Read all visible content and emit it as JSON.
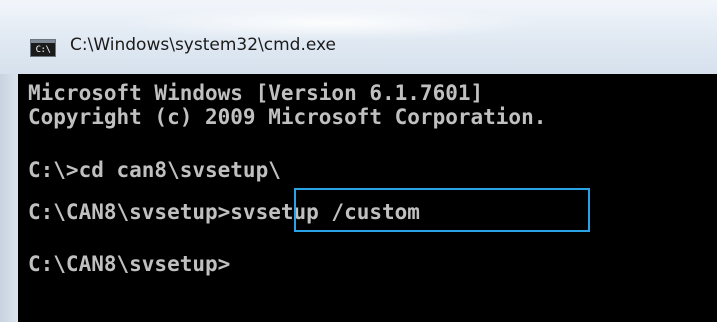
{
  "window": {
    "title": "C:\\Windows\\system32\\cmd.exe",
    "icon": "cmd-icon",
    "icon_label": "C:\\"
  },
  "console": {
    "lines": [
      "Microsoft Windows [Version 6.1.7601]",
      "Copyright (c) 2009 Microsoft Corporation.",
      "C:\\>cd can8\\svsetup\\",
      "C:\\CAN8\\svsetup>svsetup /custom",
      "C:\\CAN8\\svsetup>"
    ],
    "highlighted_command": "svsetup /custom",
    "highlight_color": "#2aa3e6",
    "text_color": "#c0c0c0",
    "background_color": "#000000"
  }
}
